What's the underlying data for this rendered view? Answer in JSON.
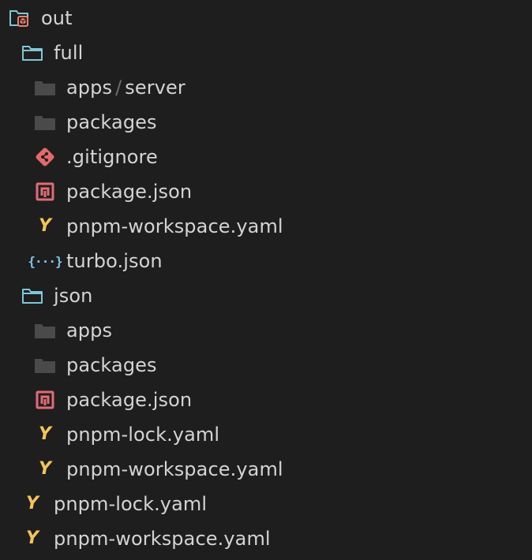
{
  "explorer": {
    "root": {
      "label": "out",
      "icon": "folder-package-open-icon"
    },
    "full": {
      "label": "full",
      "icon": "folder-open-icon",
      "items": {
        "apps_server": {
          "part1": "apps",
          "separator": "/",
          "part2": "server",
          "icon": "folder-icon"
        },
        "packages": {
          "label": "packages",
          "icon": "folder-icon"
        },
        "gitignore": {
          "label": ".gitignore",
          "icon": "git-icon"
        },
        "package_json": {
          "label": "package.json",
          "icon": "npm-icon"
        },
        "pnpm_workspace": {
          "label": "pnpm-workspace.yaml",
          "icon": "yaml-icon"
        },
        "turbo_json": {
          "label": "turbo.json",
          "icon": "json-icon",
          "glyph": "{···}"
        }
      }
    },
    "json": {
      "label": "json",
      "icon": "folder-open-icon",
      "items": {
        "apps": {
          "label": "apps",
          "icon": "folder-icon"
        },
        "packages": {
          "label": "packages",
          "icon": "folder-icon"
        },
        "package_json": {
          "label": "package.json",
          "icon": "npm-icon"
        },
        "pnpm_lock": {
          "label": "pnpm-lock.yaml",
          "icon": "yaml-icon"
        },
        "pnpm_workspace": {
          "label": "pnpm-workspace.yaml",
          "icon": "yaml-icon"
        }
      }
    },
    "pnpm_lock": {
      "label": "pnpm-lock.yaml",
      "icon": "yaml-icon"
    },
    "pnpm_workspace": {
      "label": "pnpm-workspace.yaml",
      "icon": "yaml-icon"
    },
    "yaml_glyph": "Y",
    "colors": {
      "background": "#1e1e1e",
      "text": "#d4d4d4",
      "folder_outline": "#7fc7d6",
      "folder_fill": "#4a4a4a",
      "package_accent": "#e8826a",
      "git": "#e36a6a",
      "npm": "#e06c75",
      "yaml": "#f2c45b",
      "json": "#7fc7e8"
    }
  }
}
